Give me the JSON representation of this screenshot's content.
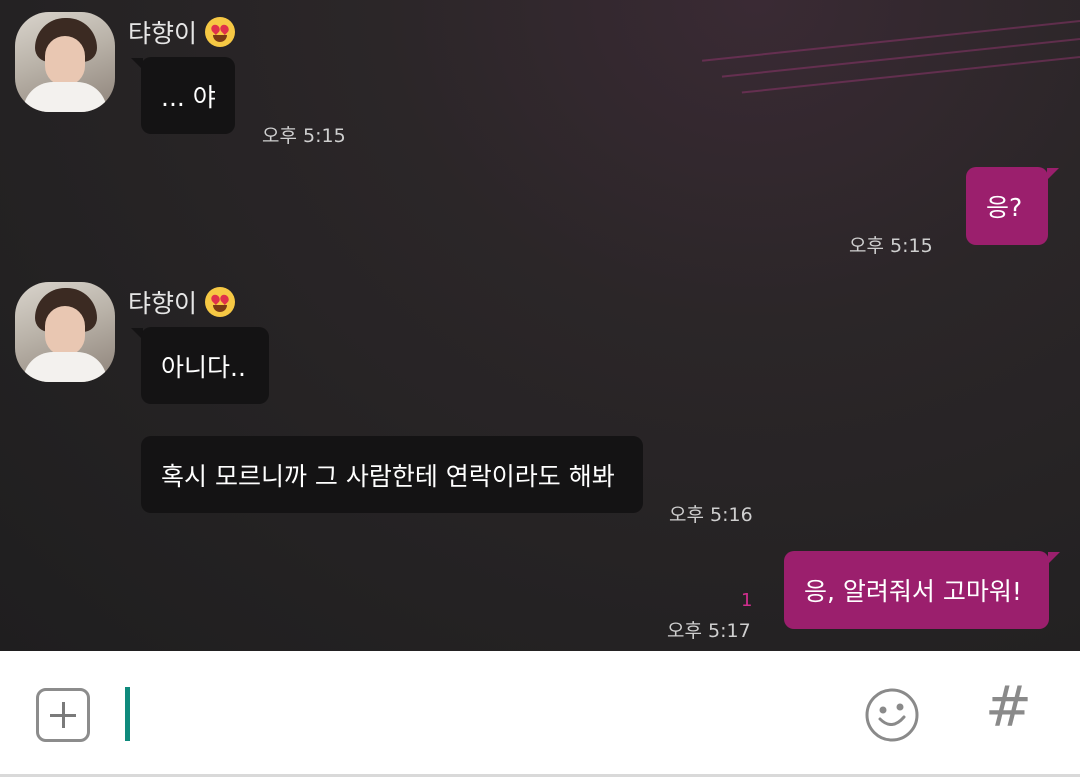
{
  "messages": [
    {
      "sender": "탸향이",
      "text": "... 야",
      "time": "오후 5:15"
    },
    {
      "text": "응?",
      "time": "오후 5:15"
    },
    {
      "sender": "탸향이",
      "text": "아니다.."
    },
    {
      "text": "혹시 모르니까 그 사람한테 연락이라도 해봐",
      "time": "오후 5:16"
    },
    {
      "text": "응, 알려줘서 고마워!",
      "time": "오후 5:17",
      "unread": "1"
    }
  ],
  "composer": {
    "plus_icon": "plus-icon",
    "emoji_icon": "smiley-icon",
    "hashtag_icon": "hashtag-icon",
    "hashtag_glyph": "#"
  },
  "colors": {
    "outgoing_bubble": "#9b1f6d",
    "incoming_bubble": "#141314",
    "unread_count": "#d12e8e",
    "cursor": "#0f8a7c"
  }
}
